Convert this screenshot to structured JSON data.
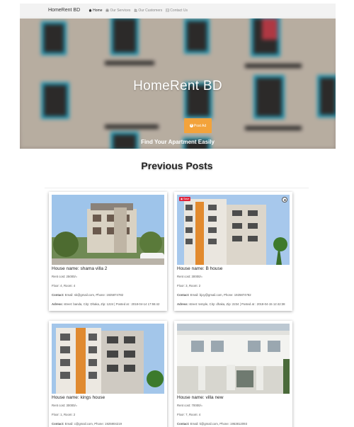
{
  "navbar": {
    "brand": "HomeRent BD",
    "links": [
      {
        "label": "Home",
        "icon": "home-icon"
      },
      {
        "label": "Our Services",
        "icon": "briefcase-icon"
      },
      {
        "label": "Our Customers",
        "icon": "users-icon"
      },
      {
        "label": "Contact Us",
        "icon": "contact-card-icon"
      }
    ]
  },
  "hero": {
    "title": "HomeRent BD",
    "button_label": "Post Ad",
    "subtitle": "Find Your Apartment Easily"
  },
  "section": {
    "title": "Previous Posts"
  },
  "posts": [
    {
      "name": "House name: shama villa 2",
      "rent": "Rent cost: 25000/=",
      "floor": "Floor: 4, Room: 4",
      "contact_label": "Contact:",
      "contact": "Email: sk@gmail.com, Phone: 1925874782",
      "address_label": "Adress:",
      "address": "street: banda, City: Dhaka, Zip: 1224 | Posted at : 2018-04-14 17:55:42"
    },
    {
      "name": "House name: B house",
      "rent": "Rent cost: 30000/=",
      "floor": "Floor: 3, Room: 2",
      "contact_label": "Contact:",
      "contact": "Email: bjoy@gmail.com, Phone: 1925874782",
      "address_label": "Adress:",
      "address": "street: temple, City: dhaka, Zip: 2234 | Posted at : 2018-04-15 12:42:38",
      "save_label": "Save"
    },
    {
      "name": "House name: kings house",
      "rent": "Rent cost: 30000/=",
      "floor": "Floor: 1, Room: 2",
      "contact_label": "Contact:",
      "contact": "Email: c@gmail.com, Phone: 1925904219"
    },
    {
      "name": "House name: villa new",
      "rent": "Rent cost: 70000/=",
      "floor": "Floor: 7, Room: 4",
      "contact_label": "Contact:",
      "contact": "Email: k@gmail.com, Phone: 1953812093"
    }
  ],
  "colors": {
    "accent": "#f3a33b",
    "nav_bg": "#f2f2f2",
    "balcony_blue": "#1aa5c8",
    "save_red": "#e0233b"
  }
}
